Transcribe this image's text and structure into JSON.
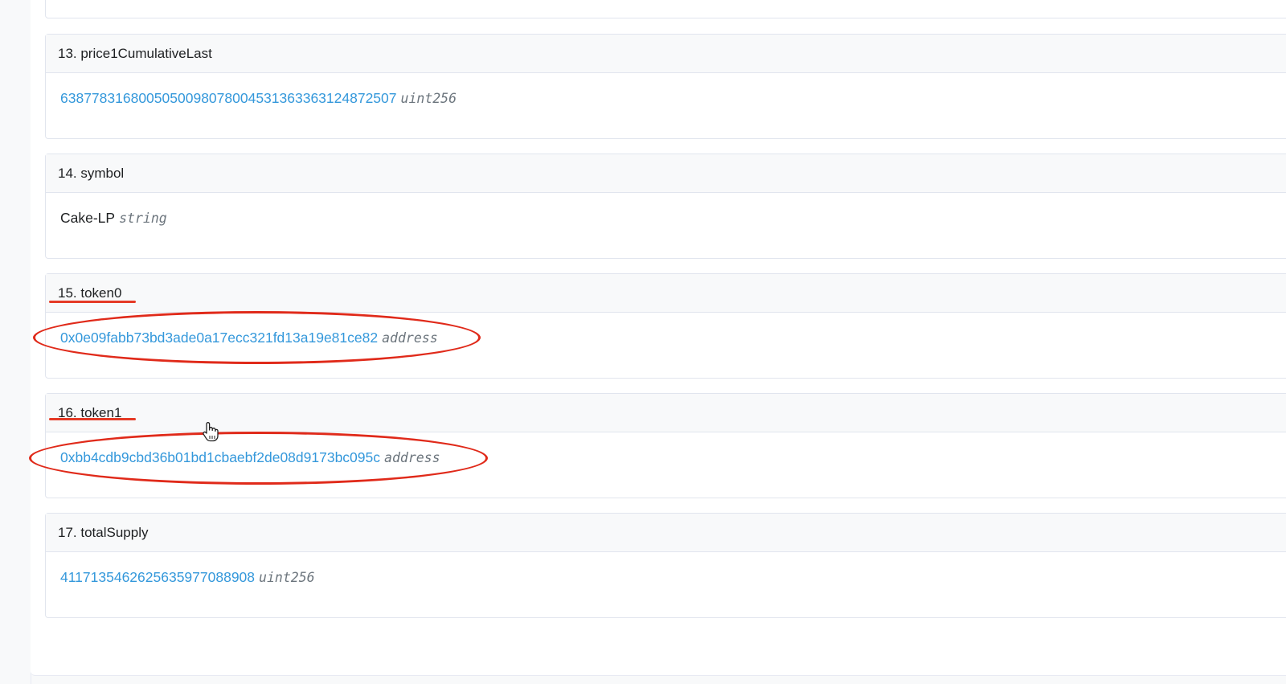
{
  "items": [
    {
      "header": "13. price1CumulativeLast",
      "value": "638778316800505009807800453136336312487250​7",
      "type": "uint256"
    },
    {
      "header": "14. symbol",
      "value": "Cake-LP",
      "type": "string"
    },
    {
      "header": "15. token0",
      "value": "0x0e09fabb73bd3ade0a17ecc321fd13a19e81ce82",
      "type": "address"
    },
    {
      "header": "16. token1",
      "value": "0xbb4cdb9cbd36b01bd1cbaebf2de08d9173bc095c",
      "type": "address"
    },
    {
      "header": "17. totalSupply",
      "value": "4117135462625635977088908",
      "type": "uint256"
    }
  ],
  "annotation": {
    "color": "#e02a1a"
  },
  "icons": {
    "cursor": "hand-pointer-icon"
  }
}
